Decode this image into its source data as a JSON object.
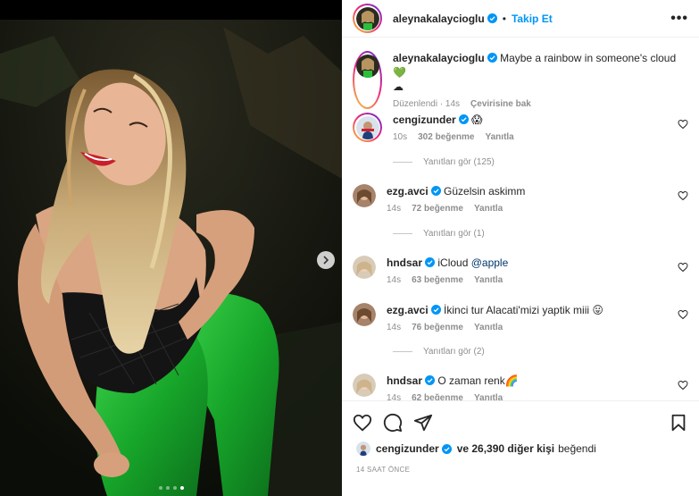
{
  "post": {
    "author": "aleynakalaycioglu",
    "follow_label": "Takip Et",
    "separator": "•",
    "more_label": "•••",
    "caption": "Maybe a rainbow in someone's cloud",
    "caption_emoji_1": "💚",
    "caption_emoji_2": "☁",
    "caption_edited": "Düzenlendi · 14s",
    "caption_translate": "Çevirisine bak"
  },
  "comments": [
    {
      "user": "cengizunder",
      "text": "",
      "emoji": "😱",
      "age": "10s",
      "likes": "302 beğenme",
      "reply": "Yanıtla",
      "view_replies": "Yanıtları gör (125)"
    },
    {
      "user": "ezg.avci",
      "text": "Güzelsin askimm",
      "emoji": "",
      "age": "14s",
      "likes": "72 beğenme",
      "reply": "Yanıtla",
      "view_replies": "Yanıtları gör (1)"
    },
    {
      "user": "hndsar",
      "text": "iCloud ",
      "mention": "@apple",
      "emoji": "",
      "age": "14s",
      "likes": "63 beğenme",
      "reply": "Yanıtla",
      "view_replies": ""
    },
    {
      "user": "ezg.avci",
      "text": "İkinci tur Alacati'mizi yaptik miii",
      "emoji": "😛",
      "age": "14s",
      "likes": "76 beğenme",
      "reply": "Yanıtla",
      "view_replies": "Yanıtları gör (2)"
    },
    {
      "user": "hndsar",
      "text": "O zaman renk",
      "emoji": "🌈",
      "age": "14s",
      "likes": "62 beğenme",
      "reply": "Yanıtla",
      "view_replies": ""
    }
  ],
  "likes_summary": {
    "user": "cengizunder",
    "rest": "ve 26,390 diğer kişi",
    "suffix": "beğendi"
  },
  "timestamp": "14 SAAT ÖNCE",
  "carousel": {
    "count": 4,
    "active_index": 3
  },
  "colors": {
    "accent": "#0095f6",
    "muted": "#8e8e8e",
    "text": "#262626"
  }
}
